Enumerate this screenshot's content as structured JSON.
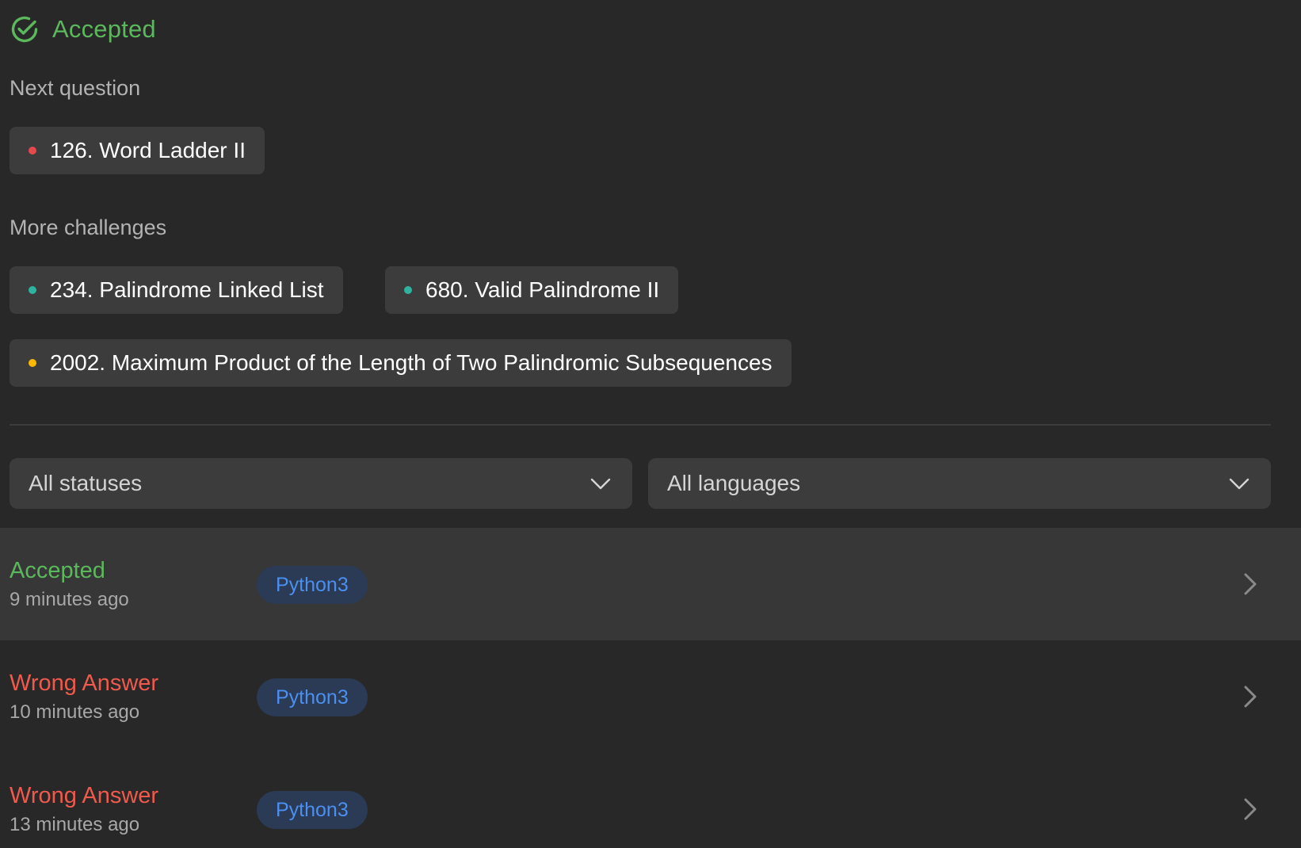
{
  "header": {
    "title": "Accepted",
    "icon": "check-circle-icon",
    "color": "#5cb85c"
  },
  "next_question": {
    "label": "Next question",
    "items": [
      {
        "title": "126. Word Ladder II",
        "difficulty_color": "#e5484d"
      }
    ]
  },
  "more_challenges": {
    "label": "More challenges",
    "items": [
      {
        "title": "234. Palindrome Linked List",
        "difficulty_color": "#2db39e"
      },
      {
        "title": "680. Valid Palindrome II",
        "difficulty_color": "#2db39e"
      },
      {
        "title": "2002. Maximum Product of the Length of Two Palindromic Subsequences",
        "difficulty_color": "#ffb800"
      }
    ]
  },
  "filters": {
    "status": {
      "selected": "All statuses",
      "icon": "chevron-down-icon"
    },
    "language": {
      "selected": "All languages",
      "icon": "chevron-down-icon"
    }
  },
  "submissions": [
    {
      "status": "Accepted",
      "status_color": "#5cb85c",
      "time": "9 minutes ago",
      "language": "Python3"
    },
    {
      "status": "Wrong Answer",
      "status_color": "#ef5a4c",
      "time": "10 minutes ago",
      "language": "Python3"
    },
    {
      "status": "Wrong Answer",
      "status_color": "#ef5a4c",
      "time": "13 minutes ago",
      "language": "Python3"
    }
  ]
}
